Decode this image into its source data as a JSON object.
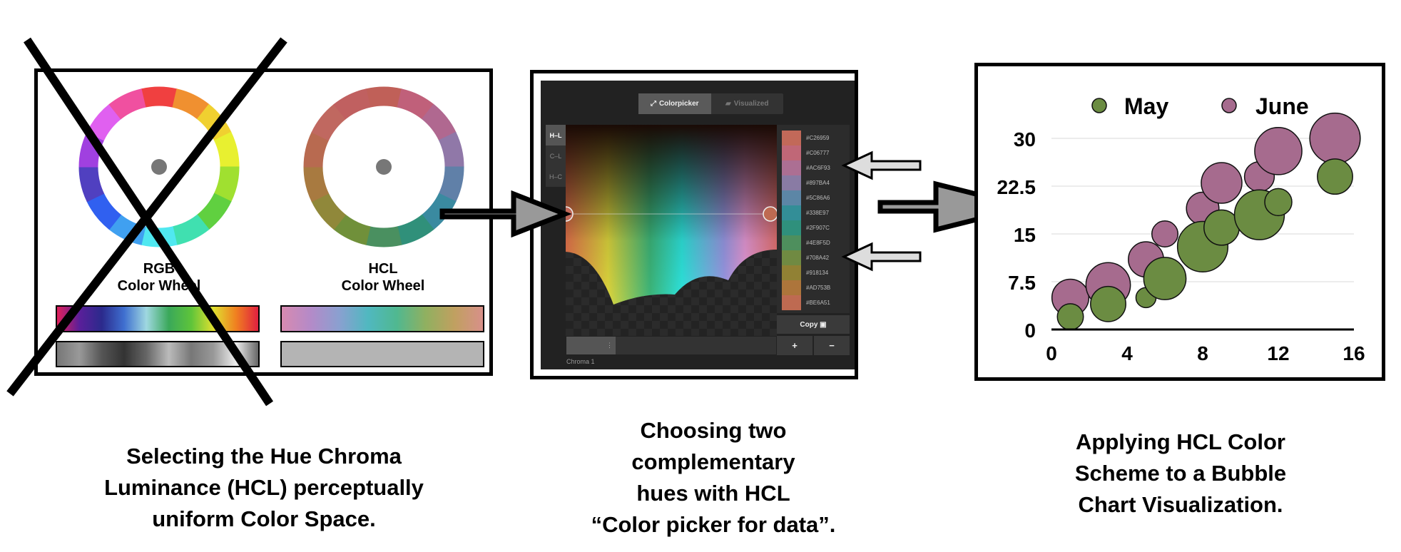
{
  "left_panel": {
    "rgb_wheel_label": [
      "RGB",
      "Color Wheel"
    ],
    "hcl_wheel_label": [
      "HCL",
      "Color Wheel"
    ],
    "crossed_out": true
  },
  "picker": {
    "tabs": [
      {
        "label": "Colorpicker",
        "icon": "wand-icon",
        "active": true
      },
      {
        "label": "Visualized",
        "icon": "map-icon",
        "active": false
      }
    ],
    "modes": [
      {
        "label": "H–L",
        "active": true
      },
      {
        "label": "C–L",
        "active": false
      },
      {
        "label": "H–C",
        "active": false
      }
    ],
    "colors": [
      "#C26959",
      "#C06777",
      "#AC6F93",
      "#897BA4",
      "#5C86A6",
      "#338E97",
      "#2F907C",
      "#4E8F5D",
      "#708A42",
      "#918134",
      "#AD753B",
      "#BE6A51"
    ],
    "highlighted": [
      "#AC6F93",
      "#708A42"
    ],
    "copy_label": "Copy",
    "plus_label": "+",
    "minus_label": "−",
    "slider_label": "Chroma 1"
  },
  "chart_data": {
    "type": "scatter",
    "subtype": "bubble",
    "legend": [
      "May",
      "June"
    ],
    "legend_placement": "top",
    "xlim": [
      0,
      16
    ],
    "ylim": [
      0,
      30
    ],
    "xticks": [
      "0",
      "4",
      "8",
      "12",
      "16"
    ],
    "yticks": [
      "0",
      "7.5",
      "15",
      "22.5",
      "30"
    ],
    "grid": true,
    "colors": {
      "May": "#6B8C42",
      "June": "#A66B8E"
    },
    "series": [
      {
        "name": "June",
        "points": [
          {
            "x": 1,
            "y": 5,
            "size": 6.8
          },
          {
            "x": 3,
            "y": 7,
            "size": 8.2
          },
          {
            "x": 5,
            "y": 11,
            "size": 6.5
          },
          {
            "x": 6,
            "y": 15,
            "size": 4.8
          },
          {
            "x": 8,
            "y": 19,
            "size": 6.0
          },
          {
            "x": 9,
            "y": 23,
            "size": 7.5
          },
          {
            "x": 11,
            "y": 24,
            "size": 5.5
          },
          {
            "x": 12,
            "y": 28,
            "size": 8.7
          },
          {
            "x": 15,
            "y": 30,
            "size": 9.3
          }
        ]
      },
      {
        "name": "May",
        "points": [
          {
            "x": 1,
            "y": 2,
            "size": 4.8
          },
          {
            "x": 3,
            "y": 4,
            "size": 6.5
          },
          {
            "x": 5,
            "y": 5,
            "size": 3.7
          },
          {
            "x": 6,
            "y": 8,
            "size": 7.8
          },
          {
            "x": 8,
            "y": 13,
            "size": 9.3
          },
          {
            "x": 9,
            "y": 16,
            "size": 6.5
          },
          {
            "x": 11,
            "y": 18,
            "size": 9.2
          },
          {
            "x": 12,
            "y": 20,
            "size": 5.0
          },
          {
            "x": 15,
            "y": 24,
            "size": 6.5
          }
        ]
      }
    ]
  },
  "captions": {
    "left": [
      "Selecting the Hue Chroma",
      "Luminance (HCL) perceptually",
      "uniform Color Space."
    ],
    "middle": [
      "Choosing two",
      "complementary",
      "hues with HCL",
      "“Color picker for data”."
    ],
    "right": [
      "Applying HCL Color",
      "Scheme to a Bubble",
      "Chart Visualization."
    ]
  }
}
